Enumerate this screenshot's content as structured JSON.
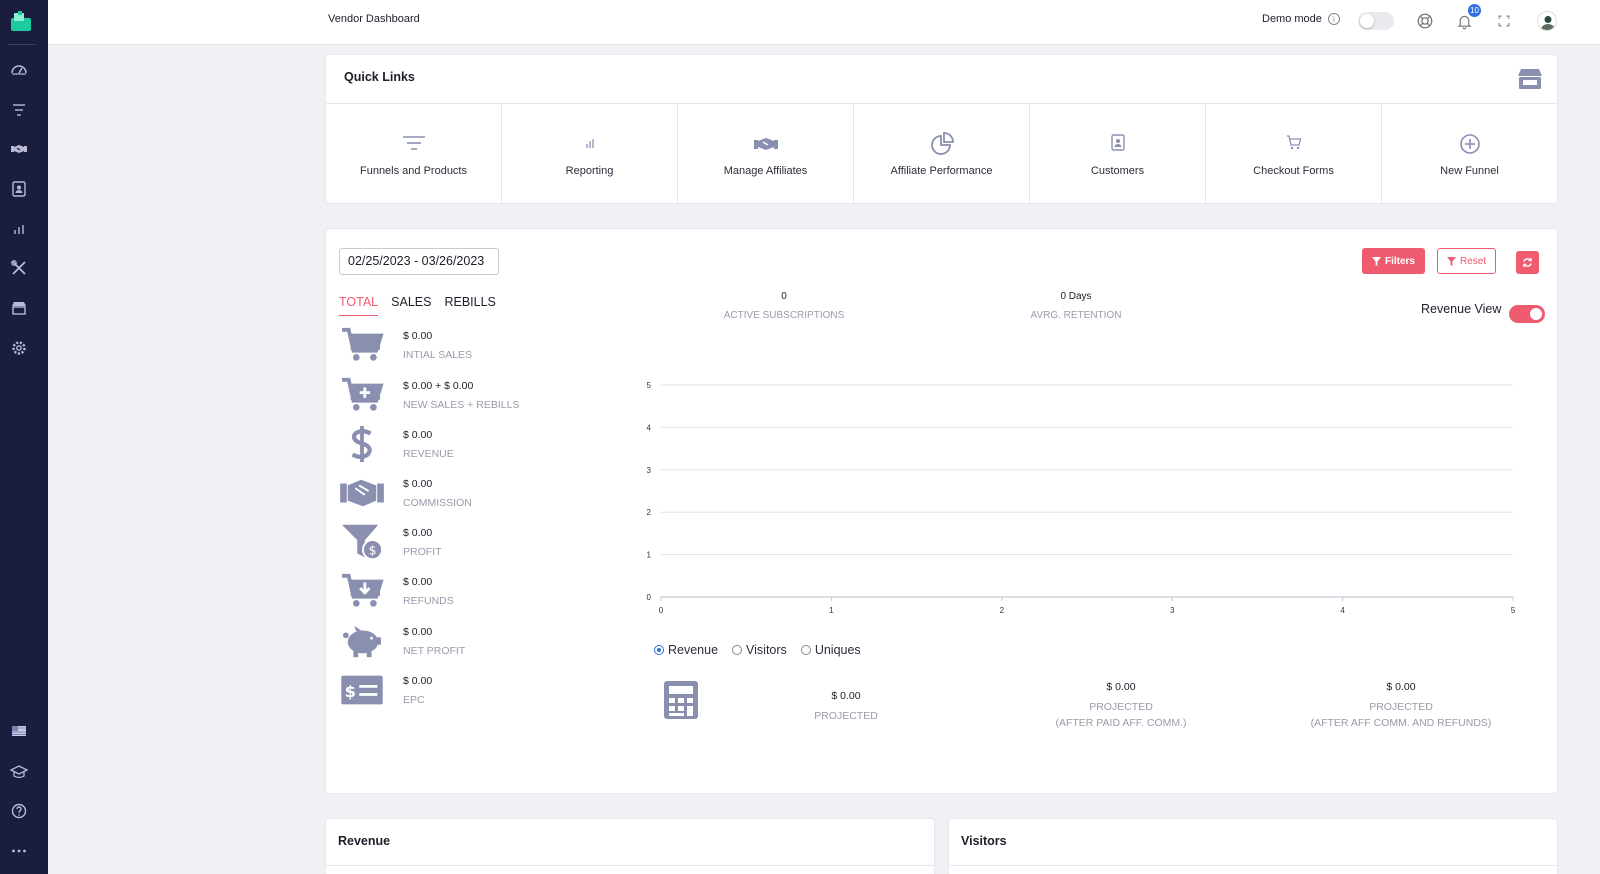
{
  "header": {
    "title": "Vendor Dashboard",
    "demo_mode_label": "Demo mode",
    "info_glyph": "i",
    "notification_count": "10"
  },
  "sidebar": {
    "icons": [
      "gauge-icon",
      "funnel-list-icon",
      "handshake-icon",
      "contacts-icon",
      "bar-chart-icon",
      "tools-icon",
      "store-icon",
      "gear-icon",
      "flag-icon",
      "graduation-cap-icon",
      "help-icon",
      "more-icon"
    ]
  },
  "quick_links": {
    "title": "Quick Links",
    "items": [
      {
        "label": "Funnels and Products",
        "icon": "funnel-lines-icon"
      },
      {
        "label": "Reporting",
        "icon": "bar-chart-icon"
      },
      {
        "label": "Manage Affiliates",
        "icon": "handshake-icon"
      },
      {
        "label": "Affiliate Performance",
        "icon": "pie-chart-icon"
      },
      {
        "label": "Customers",
        "icon": "contact-card-icon"
      },
      {
        "label": "Checkout Forms",
        "icon": "cart-icon"
      },
      {
        "label": "New Funnel",
        "icon": "plus-circle-icon"
      }
    ]
  },
  "stats": {
    "date_range": "02/25/2023 - 03/26/2023",
    "filters_label": "Filters",
    "reset_label": "Reset",
    "tabs": [
      "TOTAL",
      "SALES",
      "REBILLS"
    ],
    "active_tab": "TOTAL",
    "active_subscriptions": {
      "value": "0",
      "label": "ACTIVE SUBSCRIPTIONS"
    },
    "avg_retention": {
      "value": "0 Days",
      "label": "AVRG. RETENTION"
    },
    "revenue_view_label": "Revenue View",
    "metrics": [
      {
        "value": "$ 0.00",
        "label": "INTIAL SALES",
        "icon": "cart-icon"
      },
      {
        "value": "$ 0.00 + $ 0.00",
        "label": "NEW SALES + REBILLS",
        "icon": "cart-plus-icon"
      },
      {
        "value": "$ 0.00",
        "label": "REVENUE",
        "icon": "dollar-icon"
      },
      {
        "value": "$ 0.00",
        "label": "COMMISSION",
        "icon": "handshake-icon"
      },
      {
        "value": "$ 0.00",
        "label": "PROFIT",
        "icon": "funnel-dollar-icon"
      },
      {
        "value": "$ 0.00",
        "label": "REFUNDS",
        "icon": "cart-arrow-down-icon"
      },
      {
        "value": "$ 0.00",
        "label": "NET PROFIT",
        "icon": "piggy-bank-icon"
      },
      {
        "value": "$ 0.00",
        "label": "EPC",
        "icon": "money-check-icon"
      }
    ],
    "radios": [
      {
        "label": "Revenue",
        "checked": true
      },
      {
        "label": "Visitors",
        "checked": false
      },
      {
        "label": "Uniques",
        "checked": false
      }
    ],
    "projections": [
      {
        "value": "$ 0.00",
        "label": "PROJECTED"
      },
      {
        "value": "$ 0.00",
        "label": "PROJECTED",
        "sublabel": "(AFTER PAID AFF. COMM.)"
      },
      {
        "value": "$ 0.00",
        "label": "PROJECTED",
        "sublabel": "(AFTER AFF COMM. AND REFUNDS)"
      }
    ]
  },
  "chart_data": {
    "type": "line",
    "x_ticks": [
      "0",
      "1",
      "2",
      "3",
      "4",
      "5"
    ],
    "y_ticks": [
      "0",
      "1",
      "2",
      "3",
      "4",
      "5"
    ],
    "xlim": [
      0,
      5
    ],
    "ylim": [
      0,
      5
    ],
    "series": [],
    "grid": true
  },
  "bottom": {
    "revenue_title": "Revenue",
    "visitors_title": "Visitors"
  },
  "colors": {
    "accent": "#ef5b6f",
    "sidebar": "#1b1d3f",
    "brand": "#1ecb9e"
  }
}
